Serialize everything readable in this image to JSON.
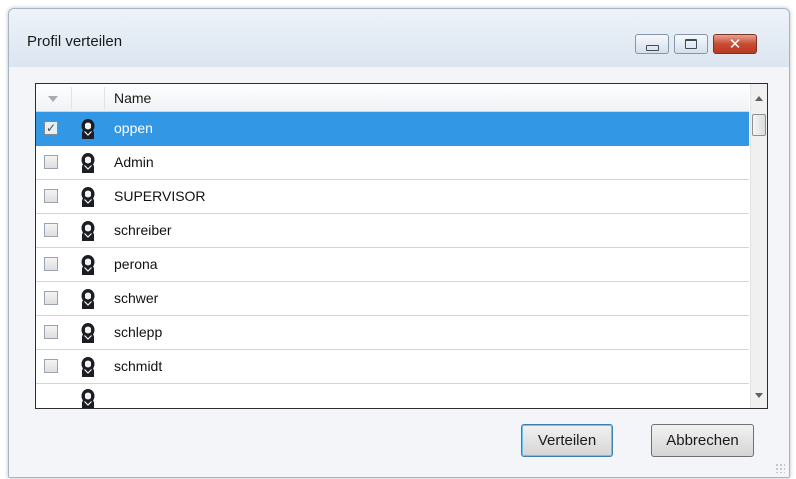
{
  "window": {
    "title": "Profil verteilen",
    "buttons": {
      "minimize": "minimize",
      "maximize": "maximize",
      "close": "close"
    }
  },
  "list": {
    "columns": {
      "name": "Name"
    },
    "rows": [
      {
        "name": "oppen",
        "checked": true,
        "selected": true
      },
      {
        "name": "Admin",
        "checked": false,
        "selected": false
      },
      {
        "name": "SUPERVISOR",
        "checked": false,
        "selected": false
      },
      {
        "name": "schreiber",
        "checked": false,
        "selected": false
      },
      {
        "name": "perona",
        "checked": false,
        "selected": false
      },
      {
        "name": "schwer",
        "checked": false,
        "selected": false
      },
      {
        "name": "schlepp",
        "checked": false,
        "selected": false
      },
      {
        "name": "schmidt",
        "checked": false,
        "selected": false
      }
    ],
    "row_icon": "user-profile-icon",
    "colors": {
      "selection": "#3298e6"
    }
  },
  "actions": {
    "verteilen_label": "Verteilen",
    "abbrechen_label": "Abbrechen"
  }
}
